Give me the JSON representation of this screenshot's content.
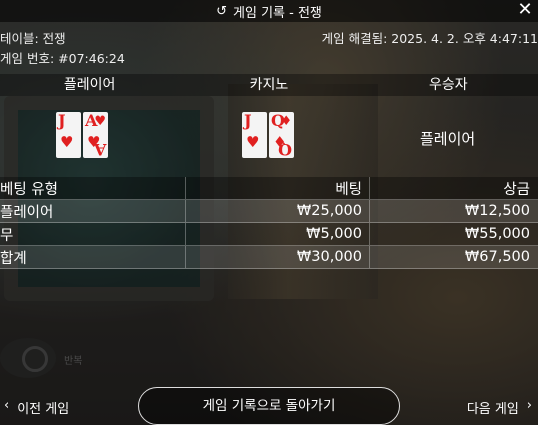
{
  "title": "게임 기록 - 전쟁",
  "table_label": "테이블: 전쟁",
  "resolved": "게임 해결됨: 2025. 4. 2. 오후 4:47:11",
  "game_number": "게임 번호: #07:46:24",
  "columns": {
    "player": "플레이어",
    "casino": "카지노",
    "winner": "우승자"
  },
  "player_cards": [
    {
      "rank": "J",
      "suit": "♥"
    },
    {
      "rank": "A",
      "suit": "♥"
    }
  ],
  "casino_cards": [
    {
      "rank": "J",
      "suit": "♥"
    },
    {
      "rank": "Q",
      "suit": "♦"
    }
  ],
  "winner_value": "플레이어",
  "bets_header": {
    "type": "베팅 유형",
    "bet": "베팅",
    "payout": "상금"
  },
  "bets": [
    {
      "type": "플레이어",
      "bet": "₩25,000",
      "payout": "₩12,500"
    },
    {
      "type": "무",
      "bet": "₩5,000",
      "payout": "₩55,000"
    },
    {
      "type": "합계",
      "bet": "₩30,000",
      "payout": "₩67,500"
    }
  ],
  "background_label": "반복",
  "footer": {
    "prev": "이전 게임",
    "back": "게임 기록으로 돌아가기",
    "next": "다음 게임",
    "prev_icon": "‹",
    "next_icon": "›"
  },
  "icons": {
    "history": "↺",
    "close": "✕"
  }
}
